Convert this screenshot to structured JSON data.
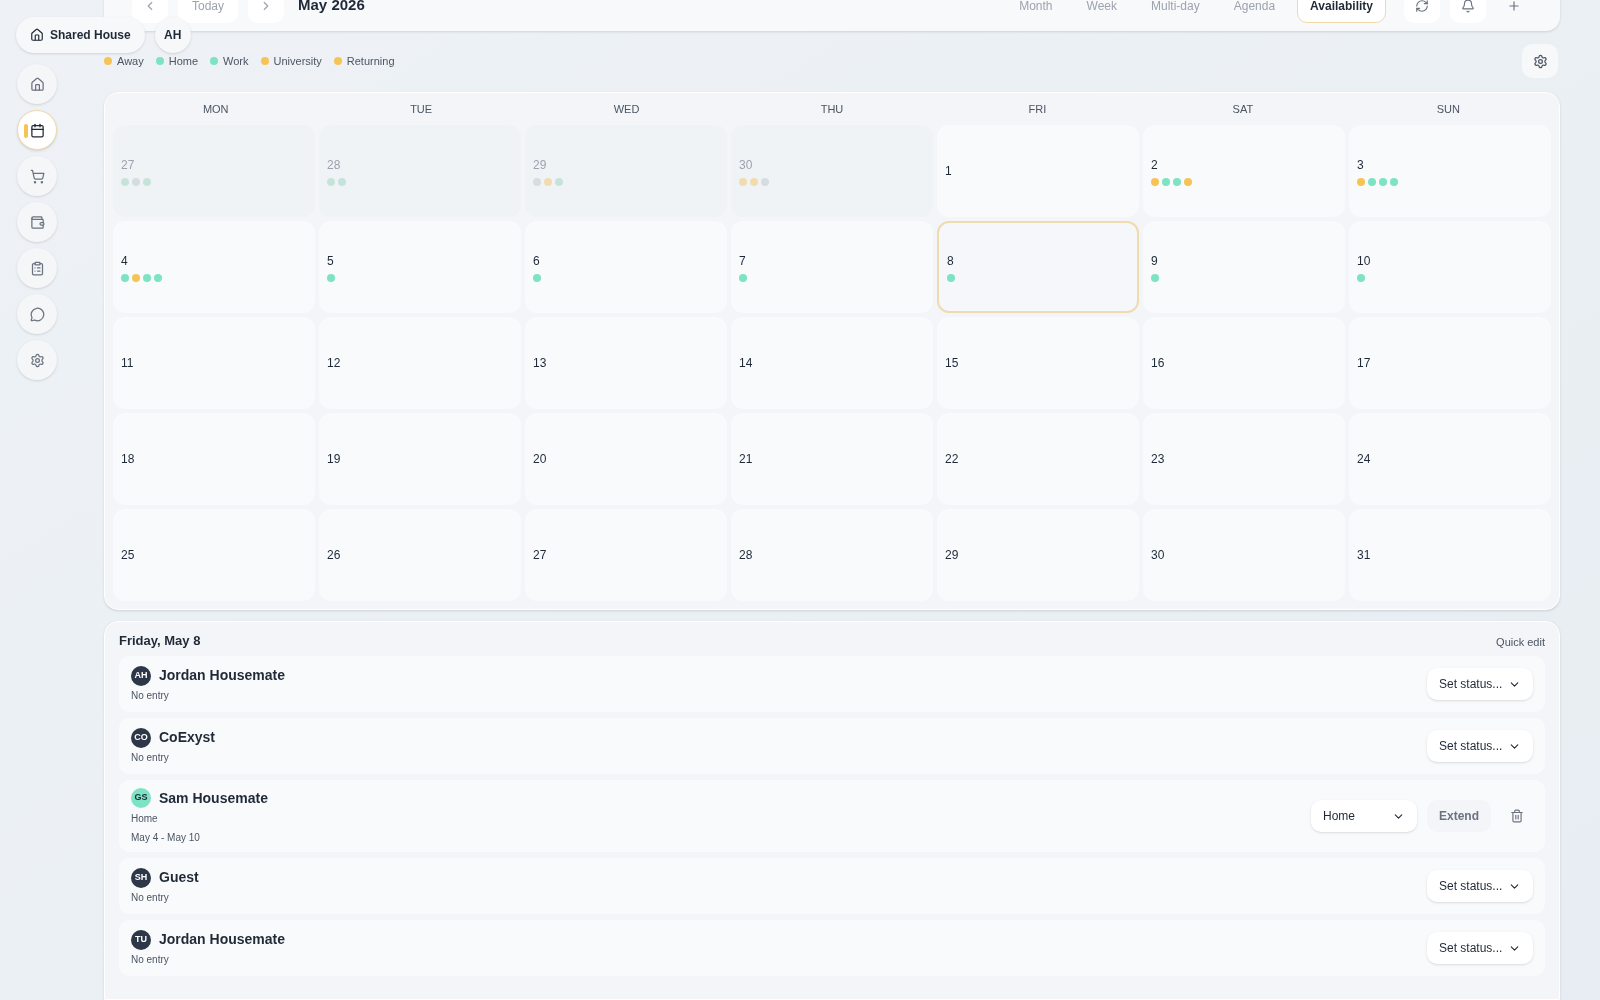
{
  "household": {
    "name": "Shared House",
    "user_initials": "AH"
  },
  "header": {
    "today": "Today",
    "month_title": "May 2026",
    "views": [
      {
        "label": "Month",
        "selected": false
      },
      {
        "label": "Week",
        "selected": false
      },
      {
        "label": "Multi-day",
        "selected": false
      },
      {
        "label": "Agenda",
        "selected": false
      },
      {
        "label": "Availability",
        "selected": true
      }
    ]
  },
  "sidebar": {
    "items": [
      {
        "selected": false
      },
      {
        "selected": true
      },
      {
        "selected": false
      },
      {
        "selected": false
      },
      {
        "selected": false
      },
      {
        "selected": false
      },
      {
        "selected": false
      }
    ]
  },
  "legend": [
    {
      "label": "Away",
      "color": "#f5c454"
    },
    {
      "label": "Home",
      "color": "#7de3c3"
    },
    {
      "label": "Work",
      "color": "#7de3c3"
    },
    {
      "label": "University",
      "color": "#f5c454"
    },
    {
      "label": "Returning",
      "color": "#f5c454"
    }
  ],
  "calendar": {
    "weekdays": [
      "MON",
      "TUE",
      "WED",
      "THU",
      "FRI",
      "SAT",
      "SUN"
    ],
    "days": [
      {
        "day": "27",
        "outside": true,
        "selected": false,
        "dots": [
          {
            "color": "#c6e3d9"
          },
          {
            "color": "#d5dde0"
          },
          {
            "color": "#c6e3d9"
          }
        ]
      },
      {
        "day": "28",
        "outside": true,
        "selected": false,
        "dots": [
          {
            "color": "#c6e3d9"
          },
          {
            "color": "#c6e3d9"
          }
        ]
      },
      {
        "day": "29",
        "outside": true,
        "selected": false,
        "dots": [
          {
            "color": "#d5dde0"
          },
          {
            "color": "#f1dcb0"
          },
          {
            "color": "#c6e3d9"
          }
        ]
      },
      {
        "day": "30",
        "outside": true,
        "selected": false,
        "dots": [
          {
            "color": "#f1dcb0"
          },
          {
            "color": "#f1dcb0"
          },
          {
            "color": "#d5dde0"
          }
        ]
      },
      {
        "day": "1",
        "outside": false,
        "selected": false
      },
      {
        "day": "2",
        "outside": false,
        "selected": false,
        "dots": [
          {
            "color": "#f5c454"
          },
          {
            "color": "#7de3c3"
          },
          {
            "color": "#7de3c3"
          },
          {
            "color": "#f5c454"
          }
        ]
      },
      {
        "day": "3",
        "outside": false,
        "selected": false,
        "dots": [
          {
            "color": "#f5c454"
          },
          {
            "color": "#7de3c3"
          },
          {
            "color": "#7de3c3"
          },
          {
            "color": "#7de3c3"
          }
        ]
      },
      {
        "day": "4",
        "outside": false,
        "selected": false,
        "dots": [
          {
            "color": "#7de3c3"
          },
          {
            "color": "#f5c454"
          },
          {
            "color": "#7de3c3"
          },
          {
            "color": "#7de3c3"
          }
        ]
      },
      {
        "day": "5",
        "outside": false,
        "selected": false,
        "dots": [
          {
            "color": "#7de3c3"
          }
        ]
      },
      {
        "day": "6",
        "outside": false,
        "selected": false,
        "dots": [
          {
            "color": "#7de3c3"
          }
        ]
      },
      {
        "day": "7",
        "outside": false,
        "selected": false,
        "dots": [
          {
            "color": "#7de3c3"
          }
        ]
      },
      {
        "day": "8",
        "outside": false,
        "selected": true,
        "dots": [
          {
            "color": "#7de3c3"
          }
        ]
      },
      {
        "day": "9",
        "outside": false,
        "selected": false,
        "dots": [
          {
            "color": "#7de3c3"
          }
        ]
      },
      {
        "day": "10",
        "outside": false,
        "selected": false,
        "dots": [
          {
            "color": "#7de3c3"
          }
        ]
      },
      {
        "day": "11",
        "outside": false,
        "selected": false
      },
      {
        "day": "12",
        "outside": false,
        "selected": false
      },
      {
        "day": "13",
        "outside": false,
        "selected": false
      },
      {
        "day": "14",
        "outside": false,
        "selected": false
      },
      {
        "day": "15",
        "outside": false,
        "selected": false
      },
      {
        "day": "16",
        "outside": false,
        "selected": false
      },
      {
        "day": "17",
        "outside": false,
        "selected": false
      },
      {
        "day": "18",
        "outside": false,
        "selected": false
      },
      {
        "day": "19",
        "outside": false,
        "selected": false
      },
      {
        "day": "20",
        "outside": false,
        "selected": false
      },
      {
        "day": "21",
        "outside": false,
        "selected": false
      },
      {
        "day": "22",
        "outside": false,
        "selected": false
      },
      {
        "day": "23",
        "outside": false,
        "selected": false
      },
      {
        "day": "24",
        "outside": false,
        "selected": false
      },
      {
        "day": "25",
        "outside": false,
        "selected": false
      },
      {
        "day": "26",
        "outside": false,
        "selected": false
      },
      {
        "day": "27",
        "outside": false,
        "selected": false
      },
      {
        "day": "28",
        "outside": false,
        "selected": false
      },
      {
        "day": "29",
        "outside": false,
        "selected": false
      },
      {
        "day": "30",
        "outside": false,
        "selected": false
      },
      {
        "day": "31",
        "outside": false,
        "selected": false
      }
    ]
  },
  "day_detail": {
    "title": "Friday, May 8",
    "quick_edit": "Quick edit",
    "members": [
      {
        "initials": "AH",
        "color": "#2d3748",
        "name": "Jordan Housemate",
        "kind": "empty",
        "status": "No entry",
        "select": "Set status..."
      },
      {
        "initials": "CO",
        "color": "#2d3748",
        "name": "CoExyst",
        "kind": "empty",
        "status": "No entry",
        "select": "Set status..."
      },
      {
        "initials": "GS",
        "color": "#7de3c3",
        "name": "Sam Housemate",
        "kind": "entry",
        "status": "Home",
        "dates": "May 4 - May 10",
        "select": "Home",
        "extend": "Extend"
      },
      {
        "initials": "SH",
        "color": "#2d3748",
        "name": "Guest",
        "kind": "empty",
        "status": "No entry",
        "select": "Set status..."
      },
      {
        "initials": "TU",
        "color": "#2d3748",
        "name": "Jordan Housemate",
        "kind": "empty",
        "status": "No entry",
        "select": "Set status..."
      }
    ]
  }
}
